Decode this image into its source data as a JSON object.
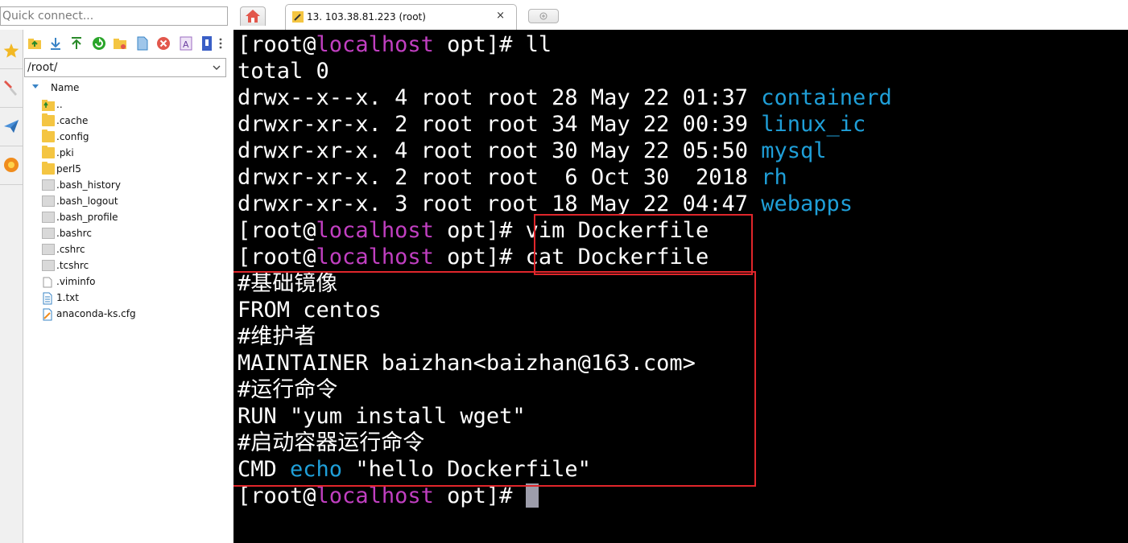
{
  "quick_connect": {
    "placeholder": "Quick connect..."
  },
  "file_browser": {
    "path": "/root/",
    "header": "Name",
    "items": [
      {
        "name": "..",
        "icon": "parent-folder-icon"
      },
      {
        "name": ".cache",
        "icon": "folder-icon"
      },
      {
        "name": ".config",
        "icon": "folder-icon"
      },
      {
        "name": ".pki",
        "icon": "folder-icon"
      },
      {
        "name": "perl5",
        "icon": "folder-icon"
      },
      {
        "name": ".bash_history",
        "icon": "file-icon"
      },
      {
        "name": ".bash_logout",
        "icon": "file-icon"
      },
      {
        "name": ".bash_profile",
        "icon": "file-icon"
      },
      {
        "name": ".bashrc",
        "icon": "file-icon"
      },
      {
        "name": ".cshrc",
        "icon": "file-icon"
      },
      {
        "name": ".tcshrc",
        "icon": "file-icon"
      },
      {
        "name": ".viminfo",
        "icon": "blank-file-icon"
      },
      {
        "name": "1.txt",
        "icon": "text-file-icon"
      },
      {
        "name": "anaconda-ks.cfg",
        "icon": "config-file-icon"
      }
    ]
  },
  "tabs": {
    "session_title": "13. 103.38.81.223 (root)",
    "close_glyph": "×"
  },
  "terminal": {
    "prompt": {
      "open": "[root@",
      "host": "localhost",
      "close": " opt]# "
    },
    "cmd_ll": "ll",
    "total": "total 0",
    "listing": [
      {
        "meta": "drwx--x--x. 4 root root 28 May 22 01:37 ",
        "name": "containerd"
      },
      {
        "meta": "drwxr-xr-x. 2 root root 34 May 22 00:39 ",
        "name": "linux_ic"
      },
      {
        "meta": "drwxr-xr-x. 4 root root 30 May 22 05:50 ",
        "name": "mysql"
      },
      {
        "meta": "drwxr-xr-x. 2 root root  6 Oct 30  2018 ",
        "name": "rh"
      },
      {
        "meta": "drwxr-xr-x. 3 root root 18 May 22 04:47 ",
        "name": "webapps"
      }
    ],
    "cmd_vim": "vim Dockerfile",
    "cmd_cat": "cat Dockerfile",
    "dockerfile": {
      "comment_base": "#基础镜像",
      "from": "FROM centos",
      "comment_maintainer": "#维护者",
      "maintainer": "MAINTAINER baizhan<baizhan@163.com>",
      "comment_run": "#运行命令",
      "run": "RUN \"yum install wget\"",
      "comment_cmd": "#启动容器运行命令",
      "cmd_prefix": "CMD ",
      "cmd_echo": "echo",
      "cmd_arg": " \"hello Dockerfile\""
    },
    "highlight_color": "#e0262b"
  }
}
